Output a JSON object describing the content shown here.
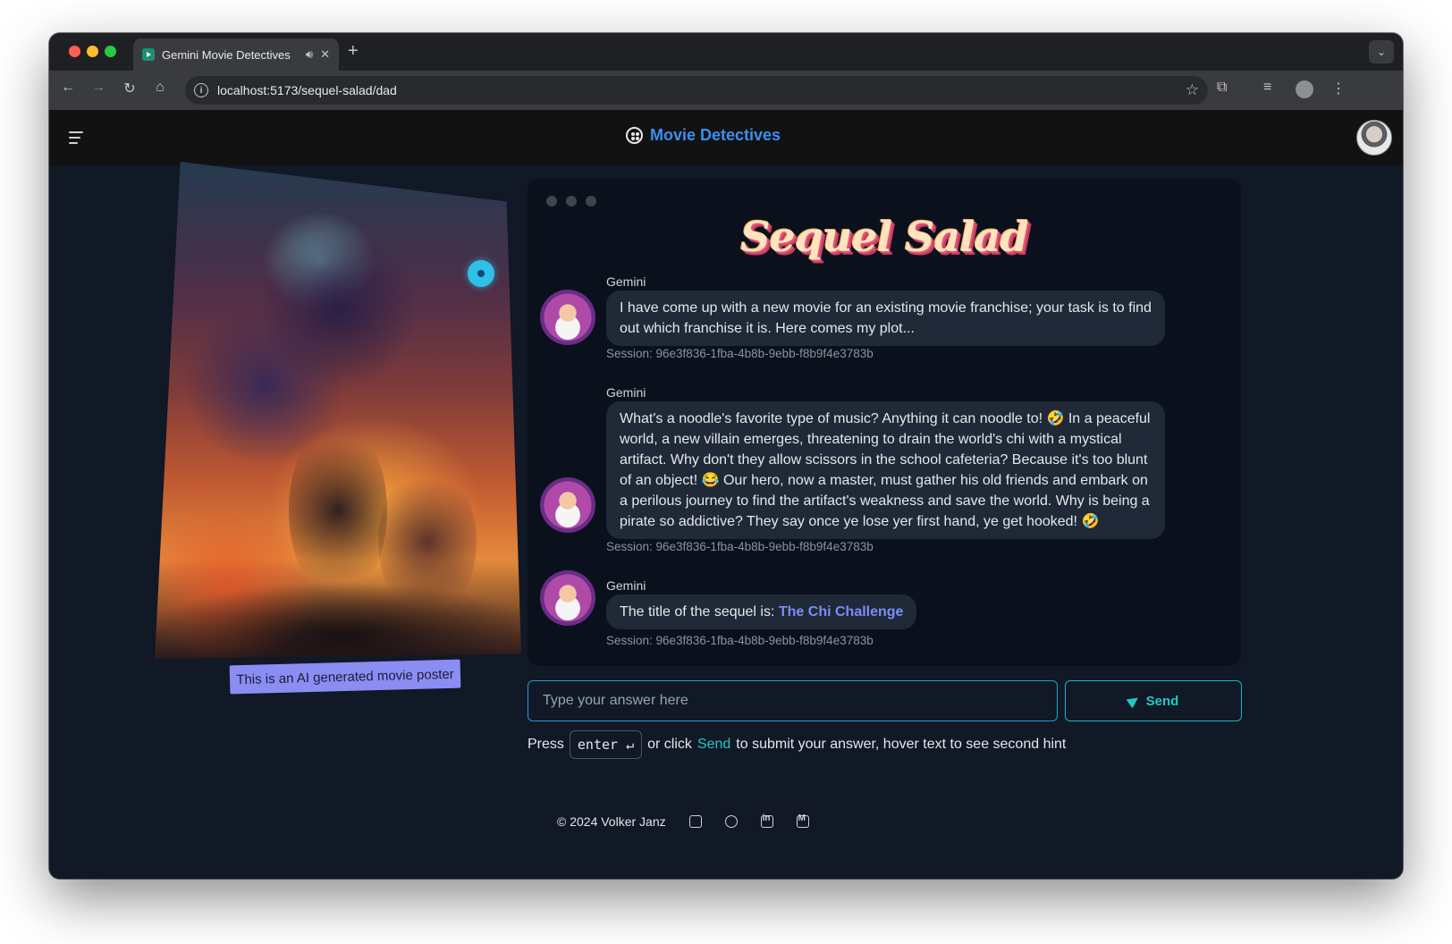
{
  "browser": {
    "tab_title": "Gemini Movie Detectives",
    "url": "localhost:5173/sequel-salad/dad"
  },
  "header": {
    "title": "Movie Detectives"
  },
  "poster": {
    "caption": "This is an AI generated movie poster"
  },
  "chat": {
    "game_title": "Sequel Salad",
    "messages": [
      {
        "author": "Gemini",
        "text": "I have come up with a new movie for an existing movie franchise; your task is to find out which franchise it is. Here comes my plot...",
        "session": "Session: 96e3f836-1fba-4b8b-9ebb-f8b9f4e3783b"
      },
      {
        "author": "Gemini",
        "text": "What's a noodle's favorite type of music? Anything it can noodle to! 🤣 In a peaceful world, a new villain emerges, threatening to drain the world's chi with a mystical artifact. Why don't they allow scissors in the school cafeteria? Because it's too blunt of an object! 😂 Our hero, now a master, must gather his old friends and embark on a perilous journey to find the artifact's weakness and save the world. Why is being a pirate so addictive? They say once ye lose yer first hand, ye get hooked! 🤣",
        "session": "Session: 96e3f836-1fba-4b8b-9ebb-f8b9f4e3783b"
      },
      {
        "author": "Gemini",
        "text_prefix": "The title of the sequel is: ",
        "answer": "The Chi Challenge",
        "session": "Session: 96e3f836-1fba-4b8b-9ebb-f8b9f4e3783b"
      }
    ]
  },
  "input": {
    "placeholder": "Type your answer here",
    "value": ""
  },
  "send_button": {
    "label": "Send"
  },
  "hint": {
    "press": "Press",
    "key": "enter ↵",
    "or_click": "or click",
    "send": "Send",
    "rest": "to submit your answer, hover text to see second hint"
  },
  "footer": {
    "copyright": "© 2024 Volker Janz"
  }
}
